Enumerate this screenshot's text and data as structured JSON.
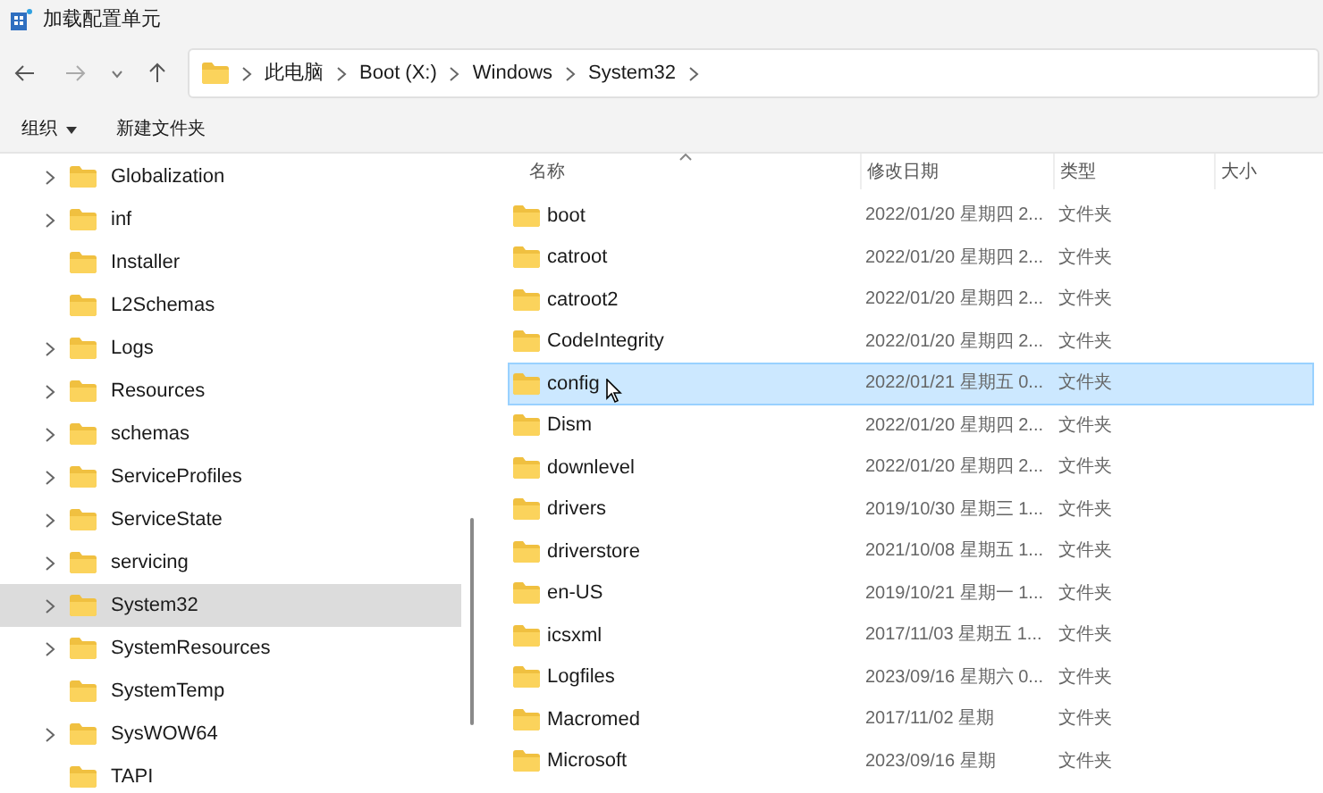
{
  "window": {
    "title": "加载配置单元"
  },
  "address_bar": {
    "crumbs": [
      "此电脑",
      "Boot (X:)",
      "Windows",
      "System32"
    ]
  },
  "toolbar": {
    "buttons": [
      {
        "label": "组织",
        "kind": "menu"
      },
      {
        "label": "新建文件夹",
        "kind": "plain"
      }
    ]
  },
  "sidebar": {
    "items": [
      {
        "label": "Globalization",
        "expandable": true,
        "selected": false
      },
      {
        "label": "inf",
        "expandable": true,
        "selected": false
      },
      {
        "label": "Installer",
        "expandable": false,
        "selected": false
      },
      {
        "label": "L2Schemas",
        "expandable": false,
        "selected": false
      },
      {
        "label": "Logs",
        "expandable": true,
        "selected": false
      },
      {
        "label": "Resources",
        "expandable": true,
        "selected": false
      },
      {
        "label": "schemas",
        "expandable": true,
        "selected": false
      },
      {
        "label": "ServiceProfiles",
        "expandable": true,
        "selected": false
      },
      {
        "label": "ServiceState",
        "expandable": true,
        "selected": false
      },
      {
        "label": "servicing",
        "expandable": true,
        "selected": false
      },
      {
        "label": "System32",
        "expandable": true,
        "selected": true
      },
      {
        "label": "SystemResources",
        "expandable": true,
        "selected": false
      },
      {
        "label": "SystemTemp",
        "expandable": false,
        "selected": false
      },
      {
        "label": "SysWOW64",
        "expandable": true,
        "selected": false
      },
      {
        "label": "TAPI",
        "expandable": false,
        "selected": false
      }
    ]
  },
  "table": {
    "columns": [
      "名称",
      "修改日期",
      "类型",
      "大小"
    ],
    "rows": [
      {
        "name": "boot",
        "date": "2022/01/20 星期四 2...",
        "type": "文件夹",
        "selected": false
      },
      {
        "name": "catroot",
        "date": "2022/01/20 星期四 2...",
        "type": "文件夹",
        "selected": false
      },
      {
        "name": "catroot2",
        "date": "2022/01/20 星期四 2...",
        "type": "文件夹",
        "selected": false
      },
      {
        "name": "CodeIntegrity",
        "date": "2022/01/20 星期四 2...",
        "type": "文件夹",
        "selected": false
      },
      {
        "name": "config",
        "date": "2022/01/21 星期五 0...",
        "type": "文件夹",
        "selected": true
      },
      {
        "name": "Dism",
        "date": "2022/01/20 星期四 2...",
        "type": "文件夹",
        "selected": false
      },
      {
        "name": "downlevel",
        "date": "2022/01/20 星期四 2...",
        "type": "文件夹",
        "selected": false
      },
      {
        "name": "drivers",
        "date": "2019/10/30 星期三 1...",
        "type": "文件夹",
        "selected": false
      },
      {
        "name": "driverstore",
        "date": "2021/10/08 星期五 1...",
        "type": "文件夹",
        "selected": false
      },
      {
        "name": "en-US",
        "date": "2019/10/21 星期一 1...",
        "type": "文件夹",
        "selected": false
      },
      {
        "name": "icsxml",
        "date": "2017/11/03 星期五 1...",
        "type": "文件夹",
        "selected": false
      },
      {
        "name": "Logfiles",
        "date": "2023/09/16 星期六 0...",
        "type": "文件夹",
        "selected": false
      },
      {
        "name": "Macromed",
        "date": "2017/11/02 星期",
        "type": "文件夹",
        "selected": false
      },
      {
        "name": "Microsoft",
        "date": "2023/09/16 星期",
        "type": "文件夹",
        "selected": false
      }
    ]
  }
}
